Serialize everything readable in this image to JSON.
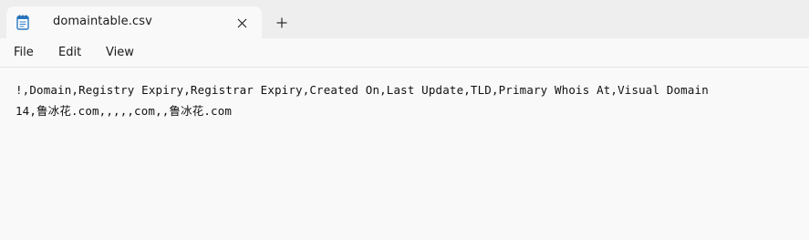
{
  "tab": {
    "title": "domaintable.csv",
    "icon": "notepad-icon",
    "close_icon": "close-icon",
    "new_tab_icon": "plus-icon"
  },
  "menu": {
    "items": [
      {
        "label": "File"
      },
      {
        "label": "Edit"
      },
      {
        "label": "View"
      }
    ]
  },
  "editor": {
    "lines": [
      "!,Domain,Registry Expiry,Registrar Expiry,Created On,Last Update,TLD,Primary Whois At,Visual Domain",
      "14,鲁冰花.com,,,,,com,,鲁冰花.com"
    ]
  },
  "colors": {
    "tabstrip": "#eeeeee",
    "background": "#f9f9f9",
    "text": "#1a1a1a",
    "icon_accent": "#2b79c2"
  }
}
